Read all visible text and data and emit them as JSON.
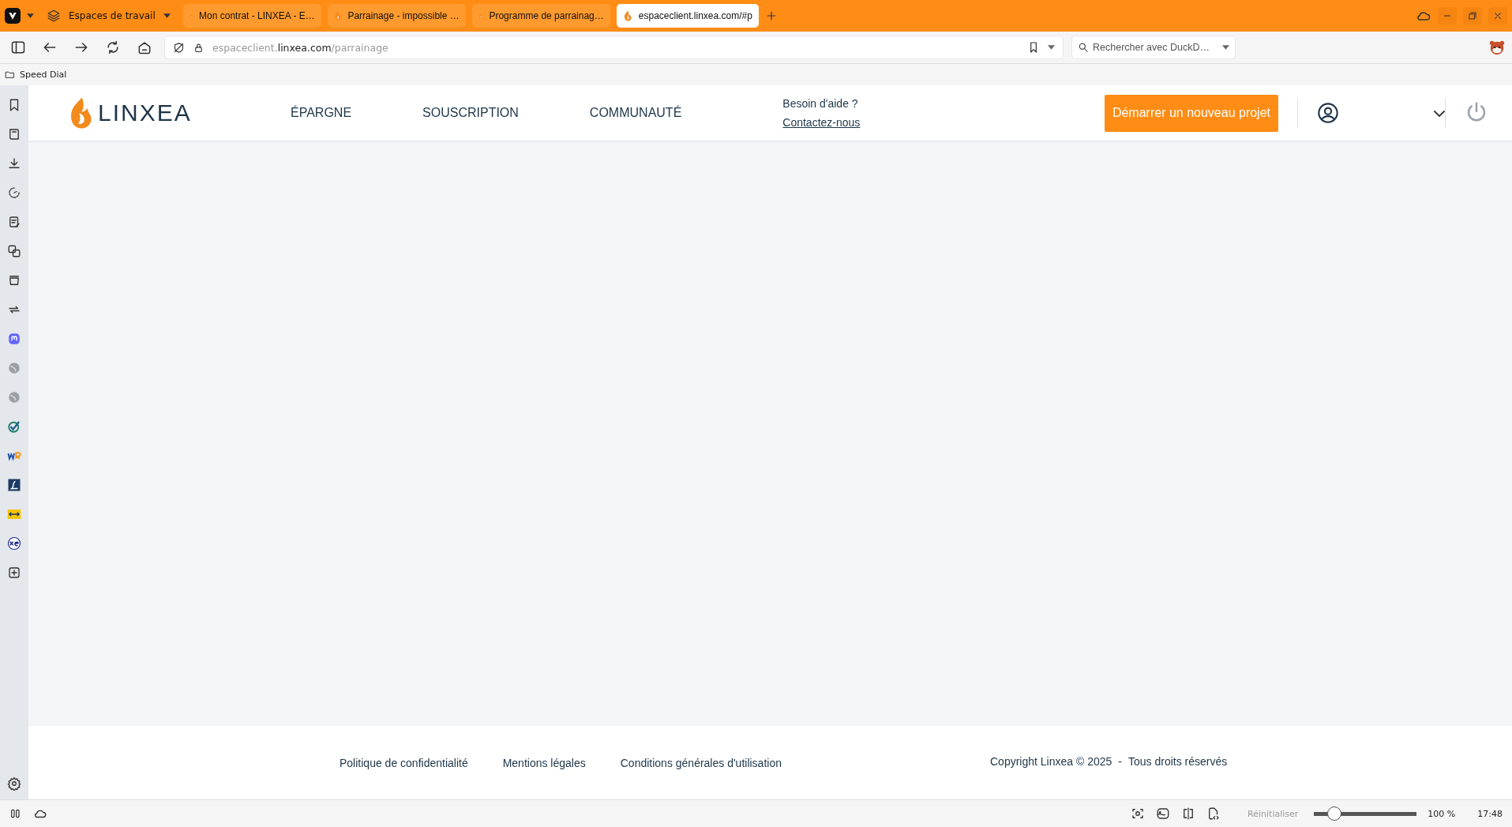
{
  "browser": {
    "workspaces": "Espaces de travail",
    "tabs": [
      {
        "title": "Mon contrat - LINXEA - E…",
        "selected": false
      },
      {
        "title": "Parrainage - impossible …",
        "selected": false
      },
      {
        "title": "Programme de parrainag…",
        "selected": false
      },
      {
        "title": "espaceclient.linxea.com/#p",
        "selected": true
      }
    ],
    "address": {
      "domain_prefix": "espaceclient.",
      "domain": "linxea.com",
      "path": "/parrainage"
    },
    "search": {
      "placeholder": "Rechercher avec DuckD…"
    },
    "bookmarks": [
      "Speed Dial"
    ],
    "panel_icons": [
      {
        "kind": "bookmark"
      },
      {
        "kind": "book"
      },
      {
        "kind": "download"
      },
      {
        "kind": "history"
      },
      {
        "kind": "notes"
      },
      {
        "kind": "translate"
      },
      {
        "kind": "reading"
      },
      {
        "kind": "sync"
      },
      {
        "kind": "mastodon"
      },
      {
        "kind": "globe"
      },
      {
        "kind": "globe"
      },
      {
        "kind": "check"
      },
      {
        "kind": "wr"
      },
      {
        "kind": "dict"
      },
      {
        "kind": "exchange"
      },
      {
        "kind": "xe"
      },
      {
        "kind": "add"
      }
    ],
    "status": {
      "reset": "Réinitialiser",
      "zoom_slider": {
        "level": 0.2
      },
      "zoom": "100 %",
      "time": "17:48"
    }
  },
  "site": {
    "logo": "LINXEA",
    "nav": [
      "ÉPARGNE",
      "SOUSCRIPTION",
      "COMMUNAUTÉ"
    ],
    "help": {
      "question": "Besoin d'aide ?",
      "link": "Contactez-nous"
    },
    "cta": "Démarrer un nouveau projet",
    "footer": {
      "links": [
        "Politique de confidentialité",
        "Mentions légales",
        "Conditions générales d'utilisation"
      ],
      "copyright": "Copyright Linxea © 2025",
      "separator": "-",
      "rights": "Tous droits réservés"
    }
  }
}
